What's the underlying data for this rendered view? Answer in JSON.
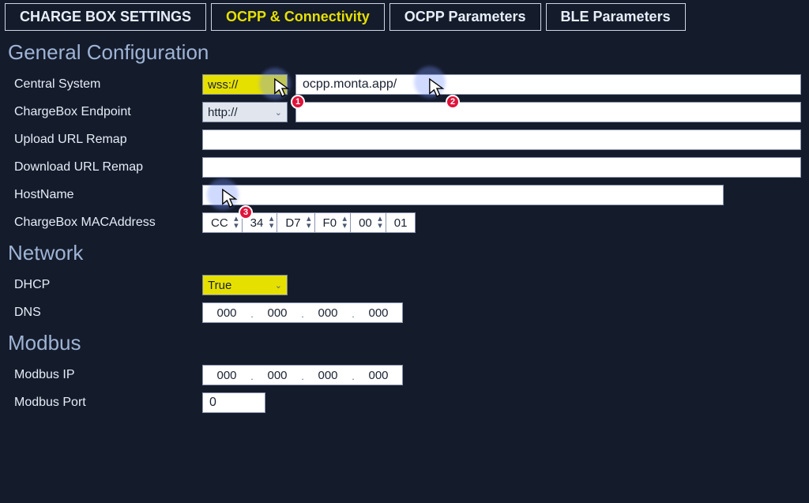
{
  "tabs": [
    {
      "label": "CHARGE BOX SETTINGS"
    },
    {
      "label": "OCPP & Connectivity"
    },
    {
      "label": "OCPP Parameters"
    },
    {
      "label": "BLE Parameters"
    }
  ],
  "sections": {
    "general": {
      "title": "General Configuration",
      "central_system": {
        "label": "Central System",
        "scheme": "wss://",
        "url": "ocpp.monta.app/"
      },
      "chargebox_endpoint": {
        "label": "ChargeBox Endpoint",
        "scheme": "http://",
        "url": ""
      },
      "upload_remap": {
        "label": "Upload URL Remap",
        "value": ""
      },
      "download_remap": {
        "label": "Download URL Remap",
        "value": ""
      },
      "hostname": {
        "label": "HostName",
        "value": ""
      },
      "mac": {
        "label": "ChargeBox MACAddress",
        "octets": [
          "CC",
          "34",
          "D7",
          "F0",
          "00",
          "01"
        ]
      }
    },
    "network": {
      "title": "Network",
      "dhcp": {
        "label": "DHCP",
        "value": "True"
      },
      "dns": {
        "label": "DNS",
        "octets": [
          "000",
          "000",
          "000",
          "000"
        ]
      }
    },
    "modbus": {
      "title": "Modbus",
      "ip": {
        "label": "Modbus IP",
        "octets": [
          "000",
          "000",
          "000",
          "000"
        ]
      },
      "port": {
        "label": "Modbus Port",
        "value": "0"
      }
    }
  },
  "annotations": {
    "1": "1",
    "2": "2",
    "3": "3"
  }
}
